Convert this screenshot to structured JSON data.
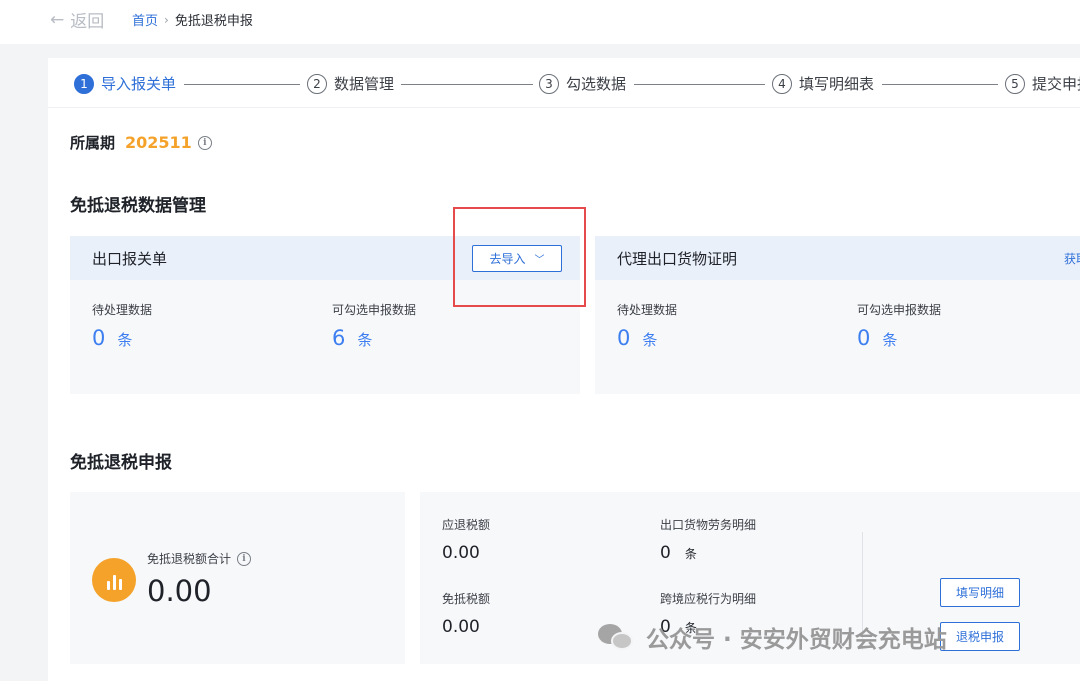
{
  "topbar": {
    "back_icon": "arrow-left-icon",
    "back_label": "返回",
    "breadcrumb": {
      "home": "首页",
      "separator": "›",
      "current": "免抵退税申报"
    }
  },
  "steps": [
    {
      "num": "1",
      "label": "导入报关单",
      "active": true
    },
    {
      "num": "2",
      "label": "数据管理",
      "active": false
    },
    {
      "num": "3",
      "label": "勾选数据",
      "active": false
    },
    {
      "num": "4",
      "label": "填写明细表",
      "active": false
    },
    {
      "num": "5",
      "label": "提交申报",
      "active": false
    }
  ],
  "period": {
    "label": "所属期",
    "value": "202511",
    "info_icon": "info-icon"
  },
  "data_mgmt": {
    "title": "免抵退税数据管理",
    "customs": {
      "title": "出口报关单",
      "import_button": "去导入",
      "stats": [
        {
          "label": "待处理数据",
          "value": "0",
          "unit": "条"
        },
        {
          "label": "可勾选申报数据",
          "value": "6",
          "unit": "条"
        }
      ]
    },
    "agency": {
      "title": "代理出口货物证明",
      "link": "获取",
      "stats": [
        {
          "label": "待处理数据",
          "value": "0",
          "unit": "条"
        },
        {
          "label": "可勾选申报数据",
          "value": "0",
          "unit": "条"
        }
      ]
    }
  },
  "declaration": {
    "title": "免抵退税申报",
    "total": {
      "label": "免抵退税额合计",
      "value": "0.00",
      "icon": "bar-chart-icon"
    },
    "refund": {
      "label": "应退税额",
      "value": "0.00"
    },
    "exempt": {
      "label": "免抵税额",
      "value": "0.00"
    },
    "export_detail": {
      "label": "出口货物劳务明细",
      "value": "0",
      "unit": "条"
    },
    "cross_border_detail": {
      "label": "跨境应税行为明细",
      "value": "0",
      "unit": "条"
    },
    "fill_button": "填写明细",
    "refund_button": "退税申报"
  },
  "watermark": {
    "text": "公众号 · 安安外贸财会充电站",
    "icon": "wechat-icon"
  },
  "colors": {
    "accent": "#2e6fd8",
    "highlight": "#e54b4b",
    "period_value": "#f5a22a"
  }
}
